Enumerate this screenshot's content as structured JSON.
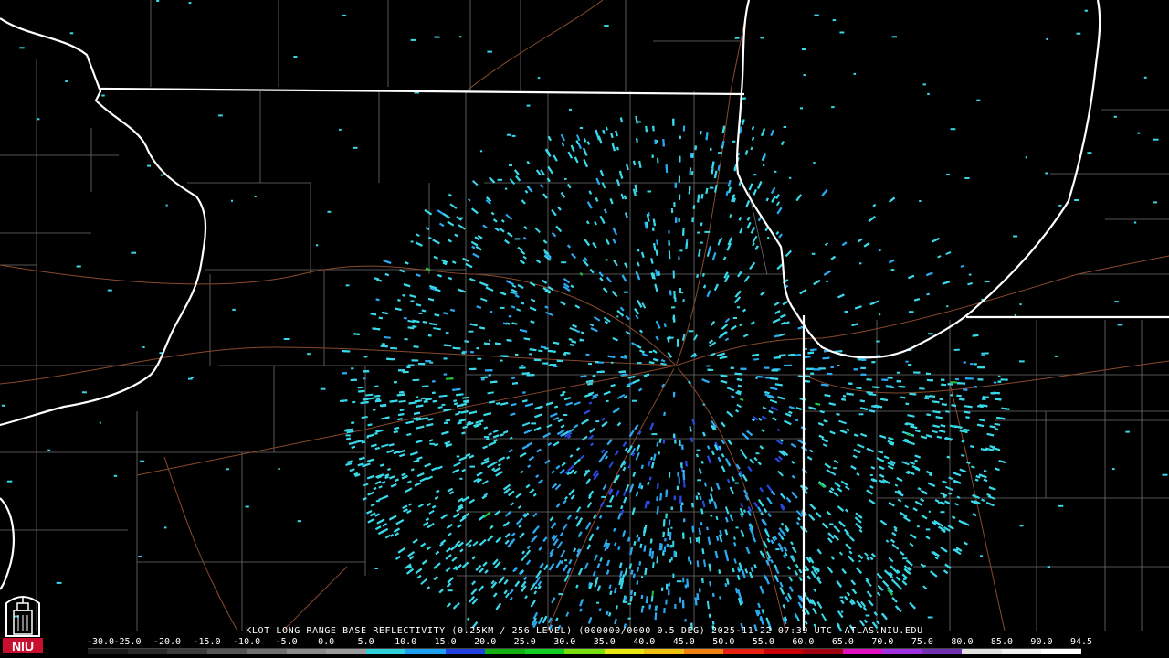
{
  "product": {
    "caption": "KLOT LONG RANGE BASE REFLECTIVITY (0.25KM / 256 LEVEL) (000000/0000 0.5 DEG) 2025-11-22 07:39 UTC  ATLAS.NIU.EDU"
  },
  "legend": {
    "labels": [
      "-30.0",
      "-25.0",
      "-20.0",
      "-15.0",
      "-10.0",
      "-5.0",
      "0.0",
      "5.0",
      "10.0",
      "15.0",
      "20.0",
      "25.0",
      "30.0",
      "35.0",
      "40.0",
      "45.0",
      "50.0",
      "55.0",
      "60.0",
      "65.0",
      "70.0",
      "75.0",
      "80.0",
      "85.0",
      "90.0",
      "94.5"
    ],
    "colors": [
      "#1a1a1a",
      "#2a2a2a",
      "#3c3c3c",
      "#555555",
      "#707070",
      "#8a8a8a",
      "#9a9a9a",
      "#30d0d8",
      "#1ea0f0",
      "#2040e0",
      "#10b010",
      "#10d020",
      "#78e010",
      "#e8e810",
      "#f0c010",
      "#f08010",
      "#e82010",
      "#c80000",
      "#a00010",
      "#e010c0",
      "#a030e0",
      "#7030b0",
      "#e0e0e0",
      "#f0f0f0",
      "#ffffff"
    ]
  },
  "colors": {
    "background": "#000000",
    "state_border": "#ffffff",
    "county_line": "#6e6e6e",
    "highway": "#8a4a2e",
    "echo_light": "#38d8e8",
    "echo_mid": "#2aa8f0",
    "echo_dark": "#2a48e0",
    "echo_green": "#22c040"
  },
  "logo": {
    "text": "NIU",
    "icon": "niu-tower-logo-icon"
  }
}
